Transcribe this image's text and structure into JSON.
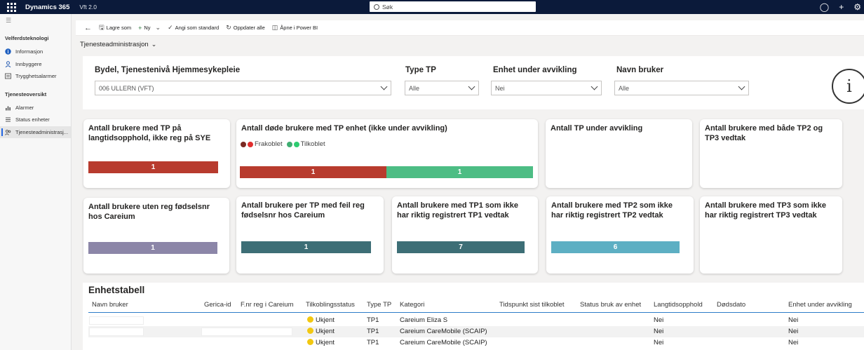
{
  "topbar": {
    "app_name": "Dynamics 365",
    "app_sub": "Vft 2.0",
    "search_placeholder": "Søk"
  },
  "sidebar": {
    "groups": [
      {
        "label": "Velferdsteknologi",
        "items": [
          {
            "label": "Informasjon",
            "icon": "info-icon"
          },
          {
            "label": "Innbyggere",
            "icon": "person-icon"
          },
          {
            "label": "Trygghetsalarmer",
            "icon": "alarm-list-icon"
          }
        ]
      },
      {
        "label": "Tjenesteoversikt",
        "items": [
          {
            "label": "Alarmer",
            "icon": "chart-icon"
          },
          {
            "label": "Status enheter",
            "icon": "list-icon"
          },
          {
            "label": "Tjenesteadministrasj...",
            "icon": "people-icon",
            "active": true
          }
        ]
      }
    ]
  },
  "commandbar": {
    "save_as": "Lagre som",
    "new": "Ny",
    "set_default": "Angi som standard",
    "refresh_all": "Oppdater alle",
    "open_powerbi": "Åpne i Power BI"
  },
  "view_title": "Tjenesteadministrasjon",
  "filters": {
    "f1": {
      "label": "Bydel, Tjenestenivå Hjemmesykepleie",
      "value": "006 ULLERN (VFT)"
    },
    "f2": {
      "label": "Type TP",
      "value": "Alle"
    },
    "f3": {
      "label": "Enhet under avvikling",
      "value": "Nei"
    },
    "f4": {
      "label": "Navn bruker",
      "value": "Alle"
    }
  },
  "cards": {
    "c1": {
      "title": "Antall brukere med TP på langtidsopphold, ikke reg på SYE",
      "value": "1"
    },
    "c2": {
      "title": "Antall døde brukere med TP enhet (ikke under avvikling)",
      "legend_a": "Frakoblet",
      "legend_b": "Tilkoblet",
      "value_a": "1",
      "value_b": "1"
    },
    "c3": {
      "title": "Antall TP under avvikling"
    },
    "c4": {
      "title": "Antall brukere med både TP2 og TP3 vedtak"
    },
    "c5": {
      "title": "Antall brukere uten reg fødselsnr hos Careium",
      "value": "1"
    },
    "c6": {
      "title": "Antall brukere per TP med feil reg fødselsnr hos Careium",
      "value": "1"
    },
    "c7": {
      "title": "Antall brukere med TP1 som ikke har riktig registrert TP1 vedtak",
      "value": "7"
    },
    "c8": {
      "title": "Antall brukere med TP2 som ikke har riktig registrert TP2 vedtak",
      "value": "6"
    },
    "c9": {
      "title": "Antall brukere med TP3 som ikke har riktig registrert TP3 vedtak"
    }
  },
  "colors": {
    "red": "#b83b2e",
    "green": "#4dbd84",
    "purple": "#8c86a8",
    "teal": "#3d6e76",
    "lightblue": "#5dafc3",
    "dot_red": "#e02e2e",
    "dot_green": "#2ecc71",
    "dot_yellow": "#f2c811"
  },
  "table": {
    "title": "Enhetstabell",
    "headers": {
      "navn": "Navn bruker",
      "gerica": "Gerica-id",
      "fnr": "F.nr reg i Careium",
      "tilk": "Tilkoblingsstatus",
      "type": "Type TP",
      "kat": "Kategori",
      "tids": "Tidspunkt sist tilkoblet",
      "status": "Status bruk av enhet",
      "lang": "Langtidsopphold",
      "dod": "Dødsdato",
      "avv": "Enhet under avvikling"
    },
    "rows": [
      {
        "tilk": "Ukjent",
        "type": "TP1",
        "kat": "Careium Eliza S",
        "lang": "Nei",
        "avv": "Nei"
      },
      {
        "tilk": "Ukjent",
        "type": "TP1",
        "kat": "Careium CareMobile (SCAIP)",
        "lang": "Nei",
        "avv": "Nei"
      },
      {
        "tilk": "Ukjent",
        "type": "TP1",
        "kat": "Careium CareMobile (SCAIP)",
        "lang": "Nei",
        "avv": "Nei"
      }
    ]
  }
}
